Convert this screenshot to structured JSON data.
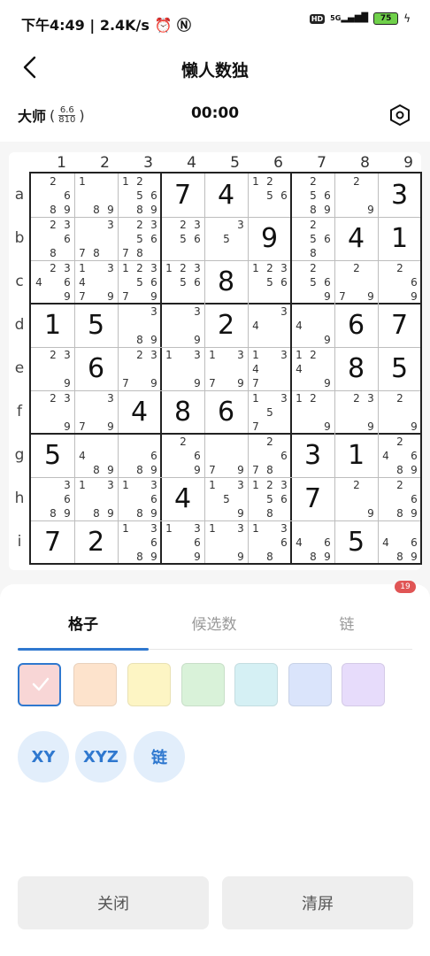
{
  "status_bar": {
    "time": "下午4:49",
    "separator": "|",
    "speed": "2.4K/s",
    "hd": "HD",
    "network": "5G",
    "battery": "75",
    "icons": [
      "alarm-icon",
      "nfc-icon",
      "signal-icon",
      "battery-icon",
      "charging-icon"
    ]
  },
  "header": {
    "title": "懒人数独",
    "back_icon": "chevron-left-icon"
  },
  "info": {
    "difficulty": "大师",
    "rating_top": "6.6",
    "rating_bottom": "810",
    "paren_open": "(",
    "paren_close": ")",
    "timer": "00:00",
    "settings_icon": "hexagon-settings-icon"
  },
  "board": {
    "col_labels": [
      "1",
      "2",
      "3",
      "4",
      "5",
      "6",
      "7",
      "8",
      "9"
    ],
    "row_labels": [
      "a",
      "b",
      "c",
      "d",
      "e",
      "f",
      "g",
      "h",
      "i"
    ],
    "cells": [
      [
        {
          "c": [
            2,
            6,
            8,
            9
          ]
        },
        {
          "c": [
            1,
            8,
            9
          ]
        },
        {
          "c": [
            1,
            2,
            5,
            6,
            8,
            9
          ]
        },
        {
          "v": 7
        },
        {
          "v": 4
        },
        {
          "c": [
            1,
            2,
            5,
            6
          ]
        },
        {
          "c": [
            2,
            5,
            6,
            8,
            9
          ]
        },
        {
          "c": [
            2,
            9
          ]
        },
        {
          "v": 3
        }
      ],
      [
        {
          "c": [
            2,
            3,
            6,
            8
          ]
        },
        {
          "c": [
            3,
            7,
            8
          ]
        },
        {
          "c": [
            2,
            3,
            5,
            6,
            7,
            8
          ]
        },
        {
          "c": [
            2,
            3,
            5,
            6
          ]
        },
        {
          "c": [
            3,
            5
          ]
        },
        {
          "v": 9
        },
        {
          "c": [
            2,
            5,
            6,
            8
          ]
        },
        {
          "v": 4
        },
        {
          "v": 1
        }
      ],
      [
        {
          "c": [
            2,
            3,
            4,
            6,
            9
          ]
        },
        {
          "c": [
            1,
            3,
            4,
            7,
            9
          ]
        },
        {
          "c": [
            1,
            2,
            3,
            5,
            6,
            7,
            9
          ]
        },
        {
          "c": [
            1,
            2,
            3,
            5,
            6
          ]
        },
        {
          "v": 8
        },
        {
          "c": [
            1,
            2,
            3,
            5,
            6
          ]
        },
        {
          "c": [
            2,
            5,
            6,
            9
          ]
        },
        {
          "c": [
            2,
            7,
            9
          ]
        },
        {
          "c": [
            2,
            6,
            9
          ]
        }
      ],
      [
        {
          "v": 1
        },
        {
          "v": 5
        },
        {
          "c": [
            3,
            8,
            9
          ]
        },
        {
          "c": [
            3,
            9
          ]
        },
        {
          "v": 2
        },
        {
          "c": [
            3,
            4
          ]
        },
        {
          "c": [
            4,
            9
          ]
        },
        {
          "v": 6
        },
        {
          "v": 7
        }
      ],
      [
        {
          "c": [
            2,
            3,
            9
          ]
        },
        {
          "v": 6
        },
        {
          "c": [
            2,
            3,
            7,
            9
          ]
        },
        {
          "c": [
            1,
            3,
            9
          ]
        },
        {
          "c": [
            1,
            3,
            7,
            9
          ]
        },
        {
          "c": [
            1,
            3,
            4,
            7
          ]
        },
        {
          "c": [
            1,
            2,
            4,
            9
          ]
        },
        {
          "v": 8
        },
        {
          "v": 5
        }
      ],
      [
        {
          "c": [
            2,
            3,
            9
          ]
        },
        {
          "c": [
            3,
            7,
            9
          ]
        },
        {
          "v": 4
        },
        {
          "v": 8
        },
        {
          "v": 6
        },
        {
          "c": [
            1,
            3,
            5,
            7
          ]
        },
        {
          "c": [
            1,
            2,
            9
          ]
        },
        {
          "c": [
            2,
            3,
            9
          ]
        },
        {
          "c": [
            2,
            9
          ]
        }
      ],
      [
        {
          "v": 5
        },
        {
          "c": [
            4,
            8,
            9
          ]
        },
        {
          "c": [
            6,
            8,
            9
          ]
        },
        {
          "c": [
            2,
            6,
            9
          ]
        },
        {
          "c": [
            7,
            9
          ]
        },
        {
          "c": [
            2,
            6,
            7,
            8
          ]
        },
        {
          "v": 3
        },
        {
          "v": 1
        },
        {
          "c": [
            2,
            4,
            6,
            8,
            9
          ]
        }
      ],
      [
        {
          "c": [
            3,
            6,
            8,
            9
          ]
        },
        {
          "c": [
            1,
            3,
            8,
            9
          ]
        },
        {
          "c": [
            1,
            3,
            6,
            8,
            9
          ]
        },
        {
          "v": 4
        },
        {
          "c": [
            1,
            3,
            5,
            9
          ]
        },
        {
          "c": [
            1,
            2,
            3,
            5,
            6,
            8
          ]
        },
        {
          "v": 7
        },
        {
          "c": [
            2,
            9
          ]
        },
        {
          "c": [
            2,
            6,
            8,
            9
          ]
        }
      ],
      [
        {
          "v": 7
        },
        {
          "v": 2
        },
        {
          "c": [
            1,
            3,
            6,
            8,
            9
          ]
        },
        {
          "c": [
            1,
            3,
            6,
            9
          ]
        },
        {
          "c": [
            1,
            3,
            9
          ]
        },
        {
          "c": [
            1,
            3,
            6,
            8
          ]
        },
        {
          "c": [
            4,
            6,
            8,
            9
          ]
        },
        {
          "v": 5
        },
        {
          "c": [
            4,
            6,
            8,
            9
          ]
        }
      ]
    ]
  },
  "panel": {
    "badge": "19",
    "tabs": [
      "格子",
      "候选数",
      "链"
    ],
    "active_tab": 0,
    "swatches": [
      "#f8d6d6",
      "#fde3cc",
      "#fdf5c4",
      "#d9f2d9",
      "#d5f0f4",
      "#dae4fb",
      "#e7dcfb"
    ],
    "selected_swatch": 0,
    "swatch_check_icon": "check-icon",
    "chips": [
      "XY",
      "XYZ",
      "链"
    ],
    "close_label": "关闭",
    "clear_label": "清屏"
  },
  "colors": {
    "accent": "#2f78cf",
    "badge": "#e05555"
  }
}
